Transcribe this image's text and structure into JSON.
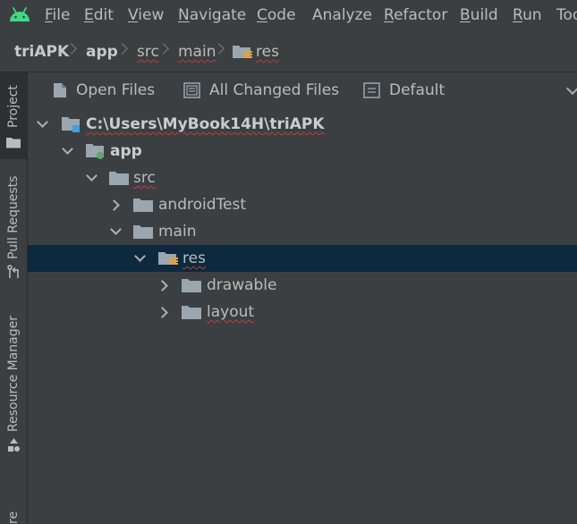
{
  "menu": {
    "items": [
      {
        "mnemonic": "F",
        "rest": "ile"
      },
      {
        "mnemonic": "E",
        "rest": "dit"
      },
      {
        "mnemonic": "V",
        "rest": "iew"
      },
      {
        "mnemonic": "N",
        "rest": "avigate"
      },
      {
        "mnemonic": "C",
        "rest": "ode"
      },
      {
        "mnemonic": "",
        "rest": "Analyze"
      },
      {
        "mnemonic": "R",
        "rest": "efactor"
      },
      {
        "mnemonic": "B",
        "rest": "uild"
      },
      {
        "mnemonic": "R",
        "rest": "un"
      },
      {
        "mnemonic": "",
        "rest": "Too"
      }
    ]
  },
  "breadcrumb": {
    "items": [
      "triAPK",
      "app",
      "src",
      "main",
      "res"
    ]
  },
  "sidebar": {
    "project_label": "Project",
    "pull_requests_label": "Pull Requests",
    "resource_manager_label": "Resource Manager",
    "bottom_label": "re"
  },
  "panel": {
    "tabs": [
      "Open Files",
      "All Changed Files",
      "Default"
    ]
  },
  "tree": {
    "root": "C:\\Users\\MyBook14H\\triAPK",
    "app": "app",
    "src": "src",
    "android_test": "androidTest",
    "main": "main",
    "res": "res",
    "drawable": "drawable",
    "layout": "layout"
  },
  "colors": {
    "background": "#3c3f41",
    "selection": "#0d293e",
    "folder": "#9aa7b0",
    "android_green": "#3ddc84",
    "module_dot": "#59a869",
    "root_badge": "#40a0e0"
  }
}
